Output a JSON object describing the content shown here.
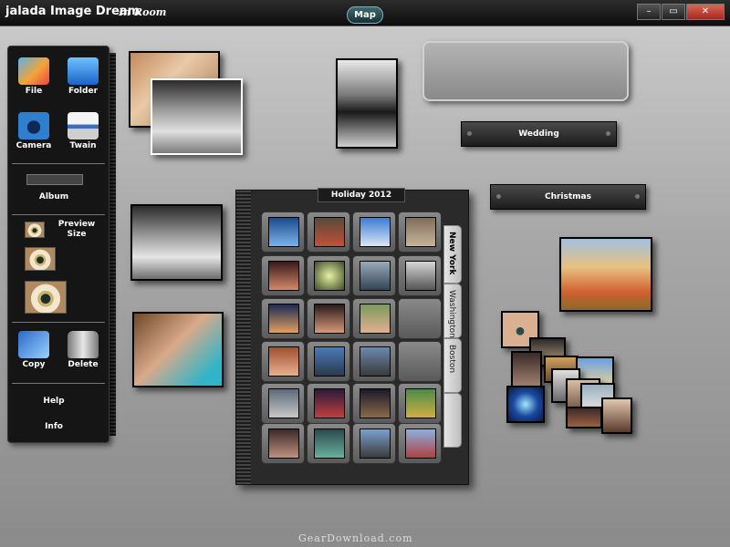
{
  "window": {
    "app_name": "jalada Image Dream",
    "view_name": "In Room",
    "map_label": "Map",
    "minimize": "–",
    "maximize": "▭",
    "close": "✕"
  },
  "toolbar": {
    "file": "File",
    "folder": "Folder",
    "camera": "Camera",
    "twain": "Twain",
    "album": "Album",
    "preview": "Preview",
    "size": "Size",
    "copy": "Copy",
    "delete": "Delete",
    "help": "Help",
    "info": "Info"
  },
  "labels": {
    "wedding": "Wedding",
    "christmas": "Christmas"
  },
  "album": {
    "title": "Holiday 2012",
    "tabs": [
      "New York",
      "Washington",
      "Boston"
    ]
  },
  "footer": {
    "watermark": "GearDownload.com"
  }
}
